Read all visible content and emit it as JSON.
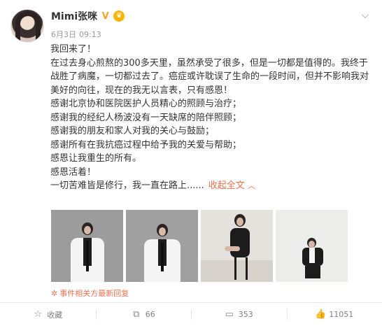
{
  "post": {
    "username": "Mimi张咪",
    "date": "6月3日",
    "time": "09:13",
    "paragraphs": [
      "我回来了！",
      "在过去身心煎熬的300多天里，虽然承受了很多，但是一切都是值得的。我终于战胜了病魔，一切都过去了。癌症或许耽误了生命的一段时间，但并不影响我对美好的向往，现在的我无以言表，只有感恩！",
      "感谢北京协和医院医护人员精心的照顾与治疗；",
      "感谢我的经纪人杨波没有一天缺席的陪伴照顾；",
      "感谢我的朋友和家人对我的关心与鼓励；",
      "感谢所有在我抗癌过程中给予我的关爱与帮助；",
      "感恩让我重生的所有。",
      "感恩活着！"
    ],
    "last_line": "一切苦难皆是修行，我一直在路上......",
    "fold_label": "收起全文",
    "related_label": "事件相关方最新回复",
    "photo_count": 4
  },
  "actions": {
    "favorite_label": "收藏",
    "repost_count": "66",
    "comment_count": "353",
    "like_count": "11051"
  },
  "icons": [
    "verified-v-icon",
    "member-crown-icon",
    "chevron-down-icon",
    "chevron-up-icon",
    "fire-icon",
    "star-icon",
    "repost-icon",
    "comment-icon",
    "thumbs-up-icon"
  ],
  "colors": {
    "link": "#eb7350",
    "text": "#333333",
    "meta": "#999999",
    "vip": "#f5a623"
  }
}
